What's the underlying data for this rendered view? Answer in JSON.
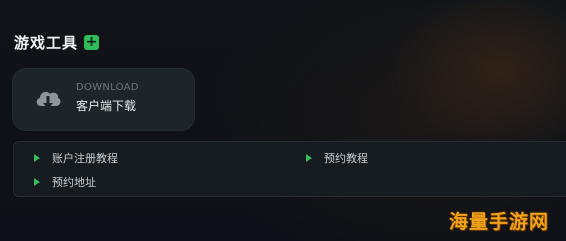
{
  "section": {
    "title": "游戏工具",
    "add_icon": "plus-icon",
    "accent": "#2fbd5b"
  },
  "download_card": {
    "icon": "cloud-download-icon",
    "sublabel": "DOWNLOAD",
    "label": "客户端下载"
  },
  "links": [
    {
      "label": "账户注册教程"
    },
    {
      "label": "预约教程"
    },
    {
      "label": "预约地址"
    }
  ],
  "watermark": "海量手游网"
}
